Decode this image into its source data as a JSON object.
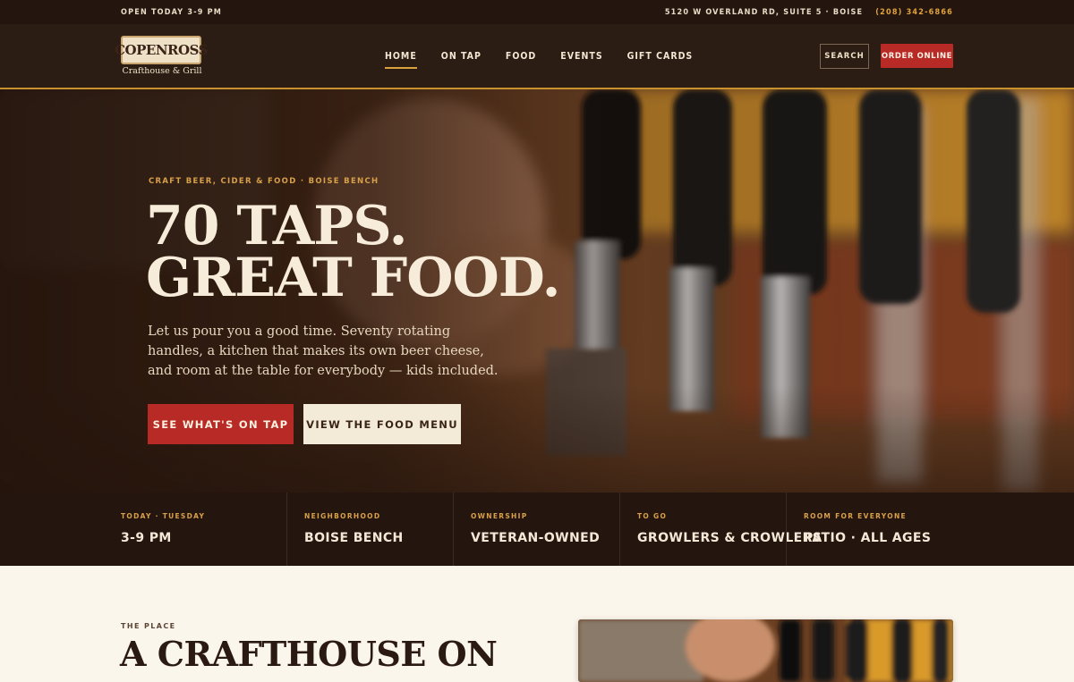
{
  "topbar": {
    "hours": "OPEN TODAY 3-9 PM",
    "address": "5120 W OVERLAND RD, SUITE 5 · BOISE",
    "phone": "(208) 342-6866"
  },
  "header": {
    "logo_name": "COPENROSS",
    "logo_tagline": "Crafthouse & Grill",
    "nav": [
      "HOME",
      "ON TAP",
      "FOOD",
      "EVENTS",
      "GIFT CARDS"
    ],
    "active_nav": "HOME",
    "search_label": "SEARCH",
    "order_label": "ORDER ONLINE"
  },
  "hero": {
    "eyebrow": "CRAFT BEER, CIDER & FOOD · BOISE BENCH",
    "headline_line1": "70 TAPS.",
    "headline_line2": "GREAT FOOD.",
    "lede": "Let us pour you a good time. Seventy rotating handles, a kitchen that makes its own beer cheese, and room at the table for everybody — kids included.",
    "cta_primary": "SEE WHAT'S ON TAP",
    "cta_secondary": "VIEW THE FOOD MENU"
  },
  "info_strip": [
    {
      "label": "TODAY · TUESDAY",
      "value": "3-9 PM"
    },
    {
      "label": "NEIGHBORHOOD",
      "value": "BOISE BENCH"
    },
    {
      "label": "OWNERSHIP",
      "value": "VETERAN-OWNED"
    },
    {
      "label": "TO GO",
      "value": "GROWLERS & CROWLERS"
    },
    {
      "label": "ROOM FOR EVERYONE",
      "value": "PATIO · ALL AGES"
    }
  ],
  "about": {
    "eyebrow": "THE PLACE",
    "title": "A CRAFTHOUSE ON"
  },
  "colors": {
    "accent_red": "#b72a25",
    "accent_gold": "#d9a03b",
    "dark_brown": "#24160f",
    "cream": "#f4ead8"
  }
}
